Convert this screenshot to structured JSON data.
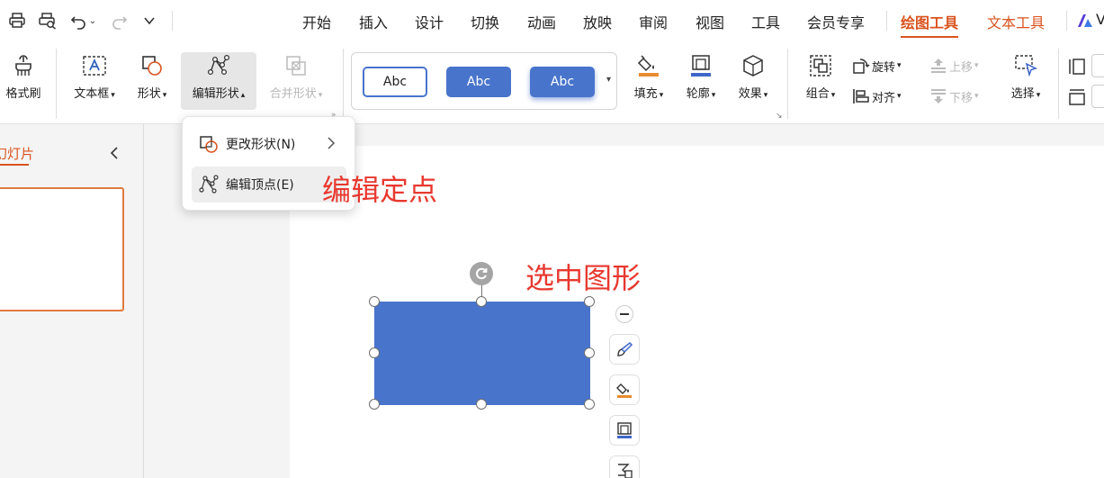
{
  "menu_tabs": [
    "开始",
    "插入",
    "设计",
    "切换",
    "动画",
    "放映",
    "审阅",
    "视图",
    "工具",
    "会员专享"
  ],
  "context_tabs": {
    "drawing_tools": "绘图工具",
    "text_tools": "文本工具"
  },
  "ribbon": {
    "format_painter": "格式刷",
    "text_box": "文本框",
    "shape": "形状",
    "edit_shape": "编辑形状",
    "merge_shape": "合并形状",
    "style_samples": [
      "Abc",
      "Abc",
      "Abc"
    ],
    "fill": "填充",
    "outline": "轮廓",
    "effect": "效果",
    "group": "组合",
    "rotate": "旋转",
    "align": "对齐",
    "move_up": "上移",
    "move_down": "下移",
    "select": "选择"
  },
  "dropdown": {
    "change_shape": "更改形状(N)",
    "edit_points": "编辑顶点(E)"
  },
  "panel": {
    "tab_label": "幻灯片"
  },
  "annotations": {
    "edit_points_note": "编辑定点",
    "select_shape_note": "选中图形"
  },
  "colors": {
    "accent": "#d9531e",
    "shape_fill": "#4874cc",
    "annotation": "#e8382f"
  }
}
